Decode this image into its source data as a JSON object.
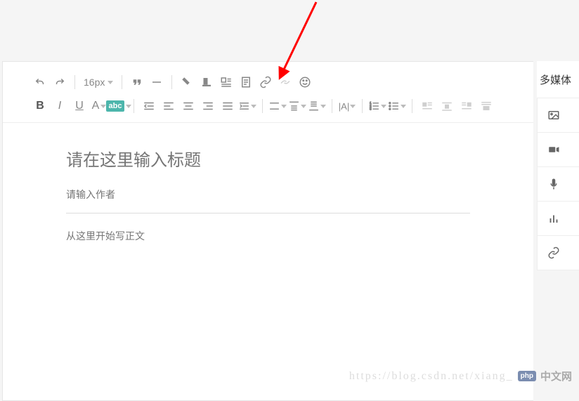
{
  "toolbar": {
    "font_size": "16px",
    "icons_row1": [
      "undo",
      "redo",
      "fontsize",
      "sep",
      "quote",
      "hr",
      "sep",
      "brush",
      "clear",
      "image-left",
      "text-doc",
      "link",
      "unlink",
      "emoji"
    ],
    "icons_row2": [
      "bold",
      "italic",
      "underline",
      "font-color",
      "highlight",
      "sep",
      "indent-left",
      "align-left",
      "align-center",
      "align-right",
      "align-justify",
      "indent-right",
      "sep",
      "line-height",
      "vertical-align",
      "spacing",
      "sep",
      "letter-spacing",
      "sep",
      "ordered-list",
      "unordered-list",
      "sep",
      "float-left",
      "float-center",
      "float-right",
      "float-none"
    ]
  },
  "content": {
    "title_placeholder": "请在这里输入标题",
    "author_placeholder": "请输入作者",
    "body_placeholder": "从这里开始写正文"
  },
  "side": {
    "title": "多媒体",
    "items": [
      {
        "icon": "image",
        "label": ""
      },
      {
        "icon": "video",
        "label": ""
      },
      {
        "icon": "audio",
        "label": ""
      },
      {
        "icon": "chart",
        "label": ""
      },
      {
        "icon": "link",
        "label": ""
      }
    ]
  },
  "watermark": {
    "url": "https://blog.csdn.net/xiang_",
    "badge": "php",
    "cn": "中文网"
  }
}
